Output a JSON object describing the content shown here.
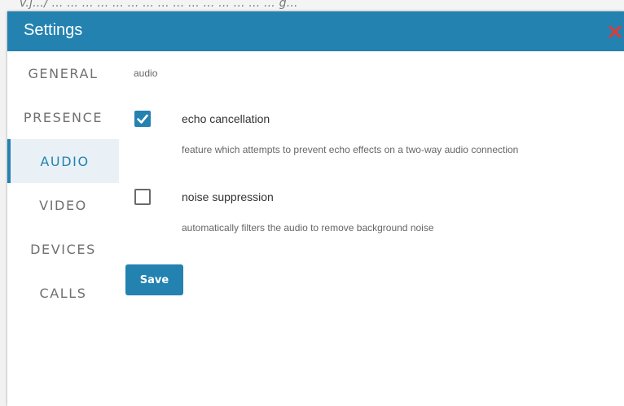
{
  "backdrop": {
    "faint_text": "v.j.../ ... ... ... ... ... ... ... ... ... ... ... ... ... ... ... g..."
  },
  "dialog": {
    "title": "Settings",
    "close_icon": "close-x-icon",
    "close_color": "#e53935"
  },
  "sidebar": {
    "items": [
      {
        "label": "GENERAL",
        "active": false
      },
      {
        "label": "PRESENCE",
        "active": false
      },
      {
        "label": "AUDIO",
        "active": true
      },
      {
        "label": "VIDEO",
        "active": false
      },
      {
        "label": "DEVICES",
        "active": false
      },
      {
        "label": "CALLS",
        "active": false
      }
    ]
  },
  "audio": {
    "section_label": "audio",
    "options": [
      {
        "title": "echo cancellation",
        "description": "feature which attempts to prevent echo effects on a two-way audio connection",
        "checked": true
      },
      {
        "title": "noise suppression",
        "description": "automatically filters the audio to remove background noise",
        "checked": false
      }
    ],
    "save_label": "Save"
  },
  "theme": {
    "accent": "#2382b0",
    "active_tab_bg": "#e9f1f6"
  }
}
